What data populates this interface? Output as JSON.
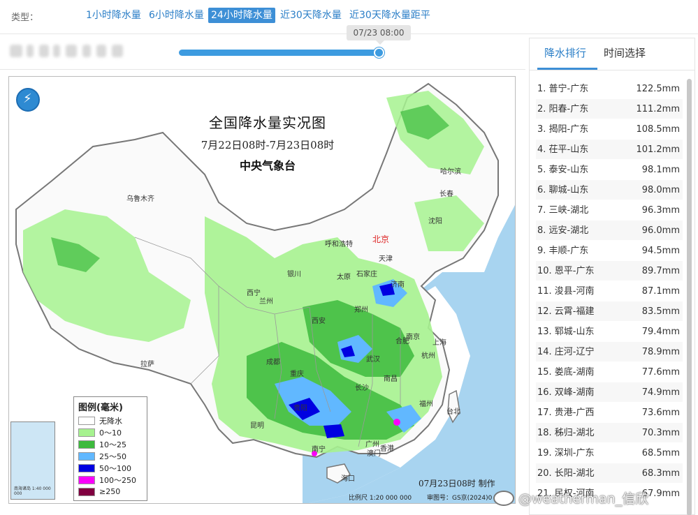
{
  "typebar": {
    "label": "类型：",
    "tabs": [
      {
        "label": "1小时降水量",
        "active": false
      },
      {
        "label": "6小时降水量",
        "active": false
      },
      {
        "label": "24小时降水量",
        "active": true
      },
      {
        "label": "近30天降水量",
        "active": false
      },
      {
        "label": "近30天降水量距平",
        "active": false
      }
    ]
  },
  "timeline": {
    "current": "07/23 08:00"
  },
  "map": {
    "title": "全国降水量实况图",
    "period": "7月22日08时-7月23日08时",
    "issuer": "中央气象台",
    "made": "07月23日08时 制作",
    "scale": "比例尺 1:20 000 000",
    "check_no": "审图号：GS京(2024)0",
    "inset_label": "南海诸岛\n1:40 000 000",
    "cities": {
      "urumqi": "乌鲁木齐",
      "lhasa": "拉萨",
      "xining": "西宁",
      "lanzhou": "兰州",
      "yinchuan": "银川",
      "hohhot": "呼和浩特",
      "beijing": "北京",
      "tianjin": "天津",
      "taiyuan": "太原",
      "shijiazhuang": "石家庄",
      "jinan": "济南",
      "zhengzhou": "郑州",
      "xian": "西安",
      "chengdu": "成都",
      "chongqing": "重庆",
      "wuhan": "武汉",
      "hefei": "合肥",
      "nanjing": "南京",
      "shanghai": "上海",
      "hangzhou": "杭州",
      "changsha": "长沙",
      "nanchang": "南昌",
      "fuzhou": "福州",
      "guiyang": "贵阳",
      "kunming": "昆明",
      "nanning": "南宁",
      "guangzhou": "广州",
      "hongkong": "香港",
      "macau": "澳门",
      "haikou": "海口",
      "taipei": "台北",
      "harbin": "哈尔滨",
      "changchun": "长春",
      "shenyang": "沈阳"
    },
    "legend": {
      "title": "图例(毫米)",
      "items": [
        {
          "label": "无降水",
          "color": "#ffffff"
        },
        {
          "label": "0～10",
          "color": "#a6f28f"
        },
        {
          "label": "10～25",
          "color": "#3dba3d"
        },
        {
          "label": "25～50",
          "color": "#61b8ff"
        },
        {
          "label": "50～100",
          "color": "#0000e1"
        },
        {
          "label": "100～250",
          "color": "#fa00fa"
        },
        {
          "label": "≥250",
          "color": "#800040"
        }
      ]
    }
  },
  "panel": {
    "tabs": [
      {
        "label": "降水排行",
        "active": true
      },
      {
        "label": "时间选择",
        "active": false
      }
    ],
    "ranking": [
      {
        "name": "1. 普宁-广东",
        "value": "122.5mm"
      },
      {
        "name": "2. 阳春-广东",
        "value": "111.2mm"
      },
      {
        "name": "3. 揭阳-广东",
        "value": "108.5mm"
      },
      {
        "name": "4. 茌平-山东",
        "value": "101.2mm"
      },
      {
        "name": "5. 泰安-山东",
        "value": "98.1mm"
      },
      {
        "name": "6. 聊城-山东",
        "value": "98.0mm"
      },
      {
        "name": "7. 三峡-湖北",
        "value": "96.3mm"
      },
      {
        "name": "8. 远安-湖北",
        "value": "96.0mm"
      },
      {
        "name": "9. 丰顺-广东",
        "value": "94.5mm"
      },
      {
        "name": "10. 恩平-广东",
        "value": "89.7mm"
      },
      {
        "name": "11. 浚县-河南",
        "value": "87.1mm"
      },
      {
        "name": "12. 云霄-福建",
        "value": "83.5mm"
      },
      {
        "name": "13. 郓城-山东",
        "value": "79.4mm"
      },
      {
        "name": "14. 庄河-辽宁",
        "value": "78.9mm"
      },
      {
        "name": "15. 娄底-湖南",
        "value": "77.6mm"
      },
      {
        "name": "16. 双峰-湖南",
        "value": "74.9mm"
      },
      {
        "name": "17. 贵港-广西",
        "value": "73.6mm"
      },
      {
        "name": "18. 秭归-湖北",
        "value": "70.3mm"
      },
      {
        "name": "19. 深圳-广东",
        "value": "68.5mm"
      },
      {
        "name": "20. 长阳-湖北",
        "value": "68.3mm"
      },
      {
        "name": "21. 民权-河南",
        "value": "67.9mm"
      }
    ]
  },
  "watermark": "@weatherman_信欣"
}
